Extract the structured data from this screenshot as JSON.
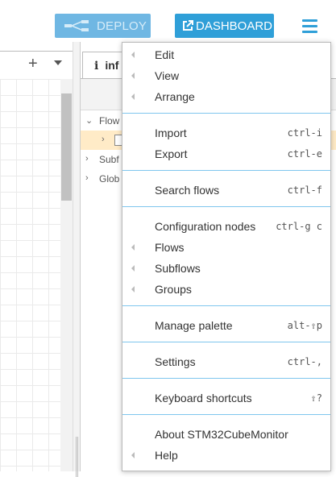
{
  "topbar": {
    "deploy_label": "DEPLOY",
    "dashboard_label": "DASHBOARD"
  },
  "workspace": {
    "add_tab": "+"
  },
  "sidebar": {
    "tab_label": "inf",
    "tree": [
      {
        "label": "Flow",
        "arrow": "⌄"
      },
      {
        "label": "",
        "arrow": "›"
      },
      {
        "label": "Subf",
        "arrow": "›"
      },
      {
        "label": "Glob",
        "arrow": "›"
      }
    ]
  },
  "menu": {
    "edit": "Edit",
    "view": "View",
    "arrange": "Arrange",
    "import": "Import",
    "import_shortcut": "ctrl-i",
    "export": "Export",
    "export_shortcut": "ctrl-e",
    "search_flows": "Search flows",
    "search_flows_shortcut": "ctrl-f",
    "configuration_nodes": "Configuration nodes",
    "configuration_nodes_shortcut": "ctrl-g c",
    "flows": "Flows",
    "subflows": "Subflows",
    "groups": "Groups",
    "manage_palette": "Manage palette",
    "manage_palette_shortcut": "alt-⇧p",
    "settings": "Settings",
    "settings_shortcut": "ctrl-,",
    "keyboard_shortcuts": "Keyboard shortcuts",
    "keyboard_shortcuts_shortcut": "⇧?",
    "about": "About STM32CubeMonitor",
    "help": "Help"
  },
  "colors": {
    "accent": "#2f9fd8",
    "deploy_disabled": "#6fb7e3",
    "separator": "#7fc6ee",
    "selected_row": "#ffebc7"
  }
}
